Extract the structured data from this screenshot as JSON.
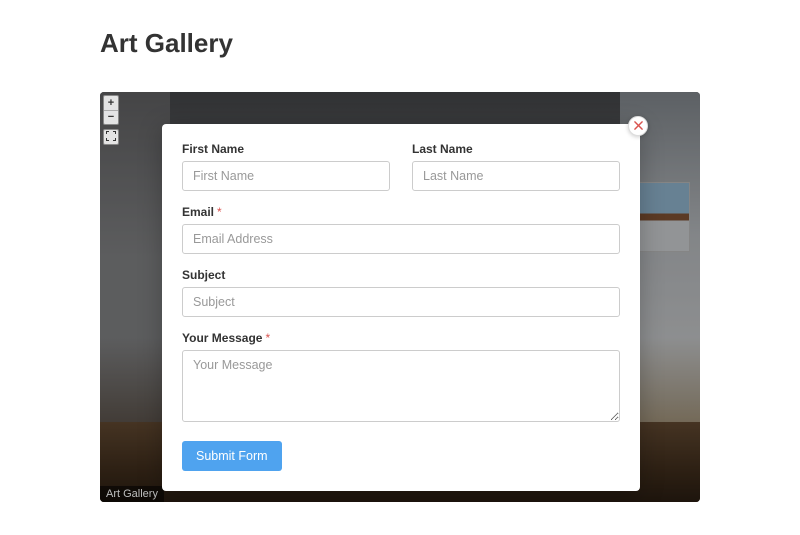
{
  "page": {
    "title": "Art Gallery",
    "viewer_caption": "Art Gallery"
  },
  "viewer": {
    "zoom_in": "+",
    "zoom_out": "−"
  },
  "form": {
    "first_name": {
      "label": "First Name",
      "placeholder": "First Name",
      "value": ""
    },
    "last_name": {
      "label": "Last Name",
      "placeholder": "Last Name",
      "value": ""
    },
    "email": {
      "label": "Email",
      "placeholder": "Email Address",
      "value": "",
      "required_mark": "*"
    },
    "subject": {
      "label": "Subject",
      "placeholder": "Subject",
      "value": ""
    },
    "message": {
      "label": "Your Message",
      "placeholder": "Your Message",
      "value": "",
      "required_mark": "*"
    },
    "submit_label": "Submit Form"
  }
}
